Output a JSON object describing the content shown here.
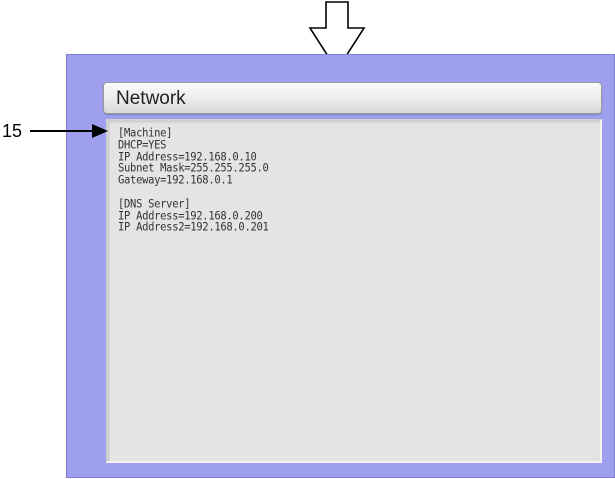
{
  "panel": {
    "title": "Network"
  },
  "callout": {
    "label": "15"
  },
  "content_lines": [
    "[Machine]",
    "DHCP=YES",
    "IP Address=192.168.0.10",
    "Subnet Mask=255.255.255.0",
    "Gateway=192.168.0.1",
    "",
    "[DNS Server]",
    "IP Address=192.168.0.200",
    "IP Address2=192.168.0.201"
  ],
  "colors": {
    "screen_background": "#9f9ff0",
    "panel_background": "#e4e4e4",
    "text": "#333333"
  },
  "icons": {
    "top_indicator": "down-arrow-outline-icon",
    "callout_pointer": "arrow-right-icon"
  }
}
